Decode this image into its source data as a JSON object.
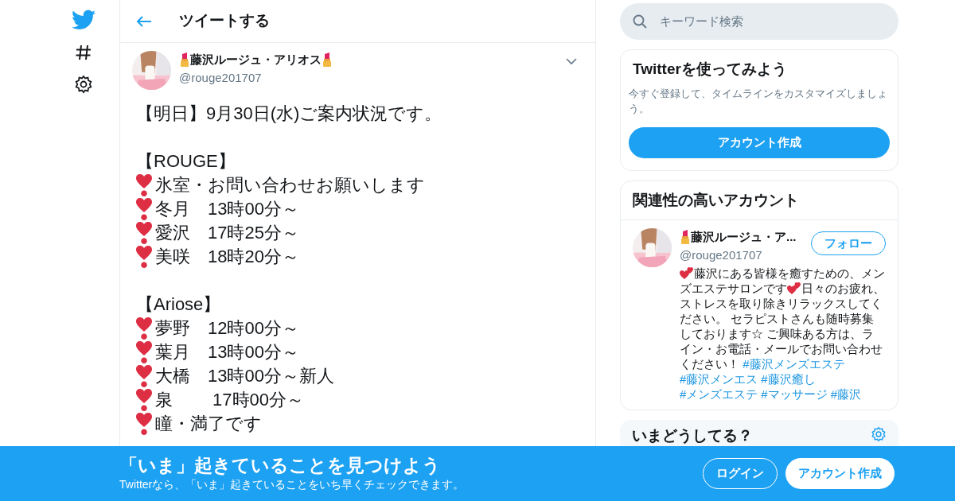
{
  "header": {
    "title": "ツイートする"
  },
  "tweet": {
    "name": "藤沢ルージュ・アリオス",
    "handle": "@rouge201707",
    "lines": [
      {
        "kind": "text",
        "text": "【明日】9月30日(水)ご案内状況です。"
      },
      {
        "kind": "blank"
      },
      {
        "kind": "text",
        "text": "【ROUGE】"
      },
      {
        "kind": "heart",
        "text": "氷室・お問い合わせお願いします"
      },
      {
        "kind": "heart",
        "text": "冬月　13時00分～"
      },
      {
        "kind": "heart",
        "text": "愛沢　17時25分～"
      },
      {
        "kind": "heart",
        "text": "美咲　18時20分～"
      },
      {
        "kind": "blank"
      },
      {
        "kind": "text",
        "text": "【Ariose】"
      },
      {
        "kind": "heart",
        "text": "夢野　12時00分～"
      },
      {
        "kind": "heart",
        "text": "葉月　13時00分～"
      },
      {
        "kind": "heart",
        "text": "大橋　13時00分～新人"
      },
      {
        "kind": "heart",
        "text": "泉　　 17時00分～"
      },
      {
        "kind": "heart",
        "text": "瞳・満了です"
      }
    ]
  },
  "search": {
    "placeholder": "キーワード検索"
  },
  "signup_card": {
    "title": "Twitterを使ってみよう",
    "text": "今すぐ登録して、タイムラインをカスタマイズしましょう。",
    "button": "アカウント作成"
  },
  "related": {
    "title": "関連性の高いアカウント",
    "name": "藤沢ルージュ・ア...",
    "handle": "@rouge201707",
    "follow": "フォロー",
    "bio": [
      {
        "kind": "hearts"
      },
      {
        "kind": "text",
        "text": "藤沢にある皆様を癒すための、メンズエステサロンです"
      },
      {
        "kind": "hearts"
      },
      {
        "kind": "text",
        "text": "日々のお疲れ、ストレスを取り除きリラックスしてください。 セラピストさんも随時募集しております☆ ご興味ある方は、ライン・お電話・メールでお問い合わせください！ "
      },
      {
        "kind": "tag",
        "text": "#藤沢メンズエステ"
      },
      {
        "kind": "tag",
        "text": "#藤沢メンエス"
      },
      {
        "kind": "tag",
        "text": "#藤沢癒し"
      },
      {
        "kind": "tag",
        "text": "#メンズエステ"
      },
      {
        "kind": "tag",
        "text": "#マッサージ"
      },
      {
        "kind": "tag",
        "text": "#藤沢"
      }
    ]
  },
  "trends": {
    "title": "いまどうしてる？"
  },
  "banner": {
    "title": "「いま」起きていることを見つけよう",
    "subtitle": "Twitterなら、「いま」起きていることをいち早くチェックできます。",
    "login": "ログイン",
    "signup": "アカウント作成"
  }
}
